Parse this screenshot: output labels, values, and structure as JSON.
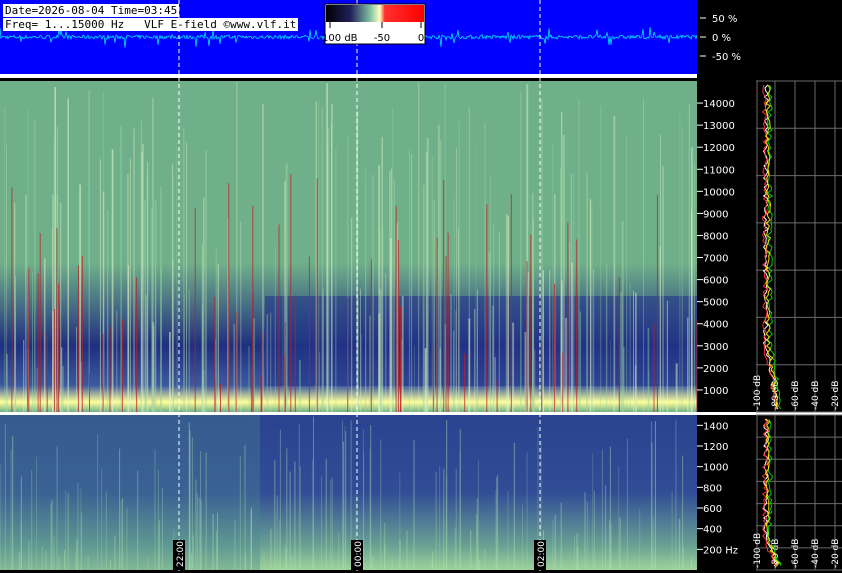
{
  "header": {
    "line1": "Date=2026-08-04 Time=03:45",
    "line2": "Freq= 1...15000 Hz   VLF E-field ©www.vlf.it"
  },
  "colorbar": {
    "labels": [
      "-100 dB",
      "-50",
      "0"
    ]
  },
  "colors": {
    "waveform_bg": "#0000ff",
    "waveform_trace": "#00e5ff",
    "spectrum_low": "#1f2f80",
    "spectrum_mid": "#6fb08a",
    "spectrum_high": "#ffff99",
    "spike": "#c02020",
    "profile_white": "#ffffff",
    "profile_green": "#00d000",
    "profile_red": "#ff3030",
    "profile_yellow": "#ffe000"
  },
  "chart_data": [
    {
      "type": "line",
      "title": "",
      "ylabel": "",
      "y_ticks": [
        "50 %",
        "0 %",
        "-50 %"
      ],
      "y_values": [
        50,
        0,
        -50
      ],
      "ylim": [
        -80,
        80
      ]
    },
    {
      "type": "heatmap",
      "ylim": [
        0,
        15000
      ],
      "y_ticks": [
        1000,
        2000,
        3000,
        4000,
        5000,
        6000,
        7000,
        8000,
        9000,
        10000,
        11000,
        12000,
        13000,
        14000
      ],
      "y_tick_labels": [
        "1000",
        "2000",
        "3000",
        "4000",
        "5000",
        "6000",
        "7000",
        "8000",
        "9000",
        "10000",
        "11000",
        "12000",
        "13000",
        "14000"
      ],
      "time_markers": [
        "22:00",
        "00:00",
        "02:00"
      ],
      "profile_x_labels": [
        "-100 dB",
        "-80 dB",
        "-60 dB",
        "-40 dB",
        "-20 dB"
      ]
    },
    {
      "type": "heatmap",
      "ylim": [
        0,
        1500
      ],
      "y_ticks": [
        200,
        400,
        600,
        800,
        1000,
        1200,
        1400
      ],
      "y_tick_labels": [
        "200 Hz",
        "400",
        "600",
        "800",
        "1000",
        "1200",
        "1400"
      ],
      "profile_x_labels": [
        "-100 dB",
        "-80 dB",
        "-60 dB",
        "-40 dB",
        "-20 dB"
      ]
    }
  ]
}
